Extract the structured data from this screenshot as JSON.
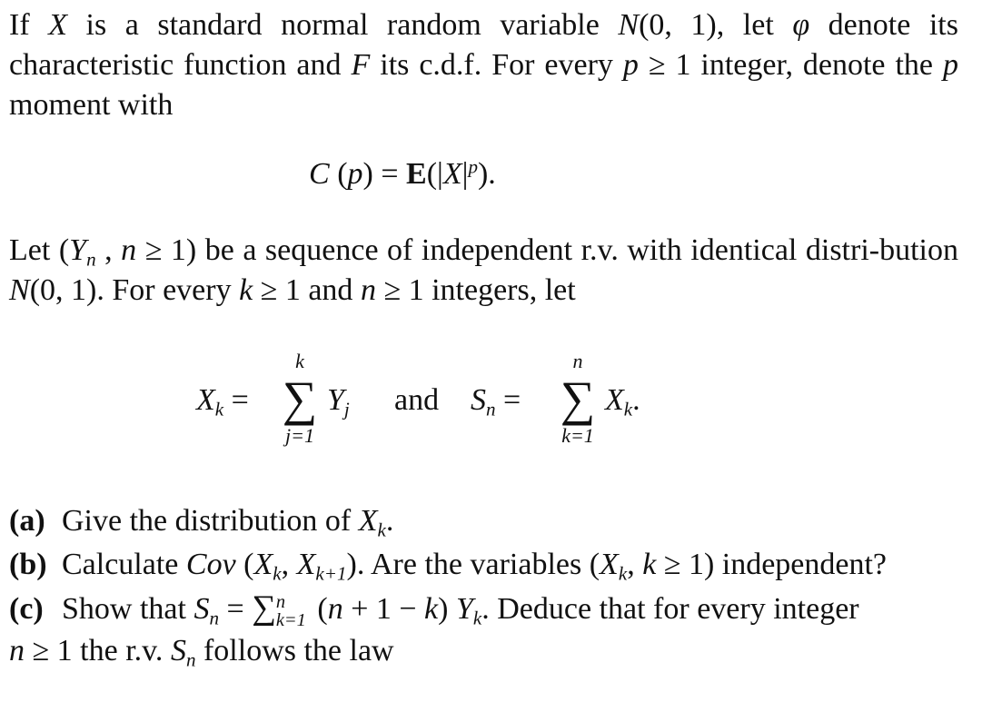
{
  "intro": {
    "t1": "If ",
    "X": "X",
    "t2": " is a standard normal random variable ",
    "N": "N",
    "t3": "(0, 1), let ",
    "phi": "φ",
    "t4": " denote its characteristic function and ",
    "F": "F",
    "t5": " its c.d.f. For every ",
    "p": "p",
    "t6": " ≥ 1 integer, denote the ",
    "p2": "p",
    "t7": " moment with"
  },
  "moment_formula": {
    "C": "C",
    "open": " (",
    "p": "p",
    "close_eq": ") = ",
    "E": "E",
    "rest1": "(|",
    "X": "X",
    "rest2": "|",
    "sup": "p",
    "rest3": ")."
  },
  "sequence": {
    "t1": "Let (",
    "Y": "Y",
    "sub_n": "n",
    "t2": " , ",
    "n": "n",
    "t3": " ≥ 1) be a sequence of independent r.v. with identical distri-bution ",
    "N": "N",
    "t4": "(0, 1). For every ",
    "k": "k",
    "t5": " ≥ 1 and ",
    "n2": "n",
    "t6": " ≥ 1 integers, let"
  },
  "sums": {
    "left_lhs": "X",
    "left_lhs_sub": "k",
    "eq": " = ",
    "left_upper": "k",
    "sigma": "∑",
    "left_lower": "j=1",
    "left_term": "Y",
    "left_term_sub": "j",
    "and": "and",
    "right_lhs": "S",
    "right_lhs_sub": "n",
    "right_upper": "n",
    "right_lower": "k=1",
    "right_term": "X",
    "right_term_sub": "k",
    "period": "."
  },
  "questions": [
    {
      "label": "(a)",
      "t1": "Give the distribution of ",
      "X": "X",
      "sub": "k",
      "t2": "."
    },
    {
      "label": "(b)",
      "t1": "Calculate ",
      "cov": "Cov",
      "t2": " (",
      "X1": "X",
      "sub1": "k",
      "t3": ", ",
      "X2": "X",
      "sub2": "k+1",
      "t4": "). Are the variables (",
      "X3": "X",
      "sub3": "k",
      "t5": ", ",
      "k": "k",
      "t6": " ≥ 1) independent?"
    },
    {
      "label": "(c)",
      "t1": "Show that ",
      "S": "S",
      "subS": "n",
      "t2": " = ",
      "sigma": "∑",
      "upper": "n",
      "lower": "k=1",
      "t3": " (",
      "n": "n",
      "t4": " + 1 − ",
      "k": "k",
      "t5": ") ",
      "Y": "Y",
      "subY": "k",
      "t6": ". Deduce that for every integer",
      "line2_n": "n",
      "line2_t1": " ≥ 1 the r.v. ",
      "line2_S": "S",
      "line2_subS": "n",
      "line2_t2": " follows the law"
    }
  ]
}
